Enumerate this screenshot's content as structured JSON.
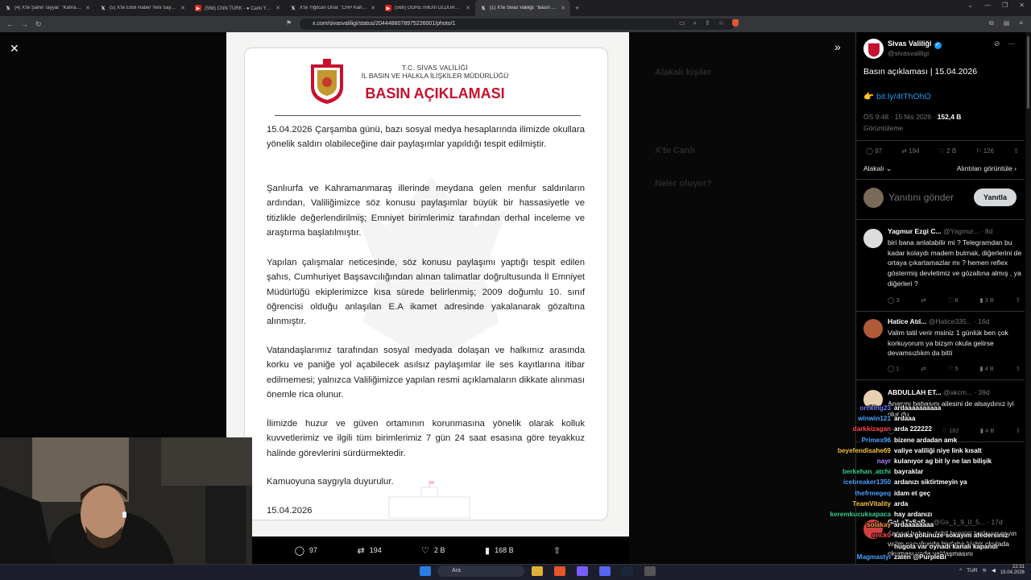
{
  "browser": {
    "tabs": [
      {
        "title": "(4) X'te Şamil Tayyar: \"Kahramanmaraş",
        "kind": "x"
      },
      {
        "title": "(5) X'te Etkili Haber Yeni Sayfa: \"Nevş",
        "kind": "x"
      },
      {
        "title": "(568) CNN TÜRK - ● Canlı Yayın ▾",
        "kind": "yt"
      },
      {
        "title": "X'te Yiğitcan Önal: \"CHP Kahramanm",
        "kind": "x"
      },
      {
        "title": "(568) ÖĞRETMENİ ÖLDÜRMEK!! (Kıs",
        "kind": "yt"
      },
      {
        "title": "(1) X'te Sivas Valiliği: \"Basın açıkla",
        "kind": "x"
      }
    ],
    "url": "x.com/sivasvaliligi/status/2044488078975226001/photo/1"
  },
  "document": {
    "header_line1": "T.C. SİVAS VALİLİĞİ",
    "header_line2": "İL BASIN VE HALKLA İLİŞKİLER MÜDÜRLÜĞÜ",
    "title": "BASIN AÇIKLAMASI",
    "paragraphs": [
      "15.04.2026 Çarşamba günü, bazı sosyal medya hesaplarında ilimizde okullara yönelik saldırı olabileceğine dair paylaşımlar yapıldığı tespit edilmiştir.",
      "Şanlıurfa ve Kahramanmaraş illerinde meydana gelen menfur saldırıların ardından, Valiliğimizce söz konusu paylaşımlar büyük bir hassasiyetle ve titizlikle değerlendirilmiş; Emniyet birimlerimiz tarafından derhal inceleme ve araştırma başlatılmıştır.",
      "Yapılan çalışmalar neticesinde, söz konusu paylaşımı yaptığı tespit edilen şahıs, Cumhuriyet Başsavcılığından alınan talimatlar doğrultusunda İl Emniyet Müdürlüğü ekiplerimizce kısa sürede belirlenmiş; 2009 doğumlu 10. sınıf öğrencisi olduğu anlaşılan E.A ikamet adresinde yakalanarak gözaltına alınmıştır.",
      "Vatandaşlarımız tarafından sosyal medyada dolaşan ve halkımız arasında korku ve paniğe yol açabilecek asılsız paylaşımlar ile ses kayıtlarına itibar edilmemesi; yalnızca Valiliğimizce yapılan resmi açıklamaların dikkate alınması önemle rica olunur.",
      "İlimizde huzur ve güven ortamının korunmasına yönelik olarak kolluk kuvvetlerimiz ve ilgili tüm birimlerimiz 7 gün 24 saat esasına göre teyakkuz halinde görevlerini sürdürmektedir."
    ],
    "closing": "Kamuoyuna saygıyla duyurulur.",
    "date": "15.04.2026"
  },
  "photo_actions": {
    "replies": "97",
    "reposts": "194",
    "likes": "2 B",
    "views": "168 B"
  },
  "background_text": {
    "related": "Alakalı kişiler",
    "x_live": "X'te Canlı",
    "whats_happening": "Neler oluyor?"
  },
  "post": {
    "name": "Sivas Valiliği",
    "handle": "@sivasvaliligi",
    "text": "Basın açıklaması | 15.04.2026",
    "link_emoji": "👉",
    "link": "bit.ly/4tThOhO",
    "time": "ÖS 9:48 · 15 Nis 2026 · ",
    "views": "152,4 B",
    "views_label": "Görüntüleme",
    "replies": "97",
    "reposts": "194",
    "likes": "2 B",
    "bookmarks": "126",
    "sort_label": "Alakalı",
    "quotes_label": "Alıntıları görüntüle",
    "reply_placeholder": "Yanıtını gönder",
    "reply_button": "Yanıtla"
  },
  "comments": [
    {
      "name": "Yagmur Ezgi C...",
      "handle": "@Yagmur... · 8d",
      "text": "biri bana anlatabilir mi ? Telegramdan bu kadar kolaydı madem bulmak, diğerlerini de ortaya çıkartamazlar mı ? hemen reflex göstermiş devletimiz ve gözaltına almış , ya diğerleri ?",
      "replies": "3",
      "likes": "8",
      "views": "3 B"
    },
    {
      "name": "Hatice Atıl...",
      "handle": "@Hatice335... · 16d",
      "text": "Valim tatil verir msiniz 1 günlük ben çok korkuyorum ya bizşm okula gelirse devamsızlıkm da bitti",
      "replies": "1",
      "likes": "5",
      "views": "4 B"
    },
    {
      "name": "ABDULLAH ET...",
      "handle": "@akcm... · 39d",
      "text": "Anasını babasını ailesini de alsaydınız iyi olur du",
      "replies": "",
      "likes": "182",
      "views": "4 B"
    },
    {
      "name": "GaLaTaSaR...",
      "handle": "@Gs_1_9_0_5... · 17d",
      "text": "Annesi babası dahil hepsini toplayın sayın valim çocuğunda birdaha hiçbir okulada okuması yada yaklaşmasını",
      "replies": "",
      "likes": "127",
      "views": "4 B"
    }
  ],
  "chat": [
    {
      "user": "orcking23",
      "msg": "ardaaaaaaaaaa",
      "color": "#6b7cff"
    },
    {
      "user": "winwin121",
      "msg": "ardaaa",
      "color": "#4aa3ff"
    },
    {
      "user": "darkkizagan",
      "msg": "arda 222222",
      "color": "#ff4d4d"
    },
    {
      "user": "Primex96",
      "msg": "bizene ardadan amk",
      "color": "#4aa3ff"
    },
    {
      "user": "beyefendisahe69",
      "msg": "valiye valiliği niye link kısalt",
      "color": "#f5c542"
    },
    {
      "user": "nayr",
      "msg": "kulanıyor ag bit ly ne lan bilişik",
      "color": "#b084ff"
    },
    {
      "user": "berkehan_atchi",
      "msg": "bayraklar",
      "color": "#3ccf8e"
    },
    {
      "user": "icebreaker1350",
      "msg": "ardanızı siktirtmeyin ya",
      "color": "#4aa3ff"
    },
    {
      "user": "thefrmegeq",
      "msg": "idam et geç",
      "color": "#4aa3ff"
    },
    {
      "user": "TeamVitality",
      "msg": "arda",
      "color": "#f5c542"
    },
    {
      "user": "keremkucuksapaca",
      "msg": "hay ardanızı",
      "color": "#3ccf8e"
    },
    {
      "user": "solakay",
      "msg": "ardaaaaaaaa",
      "color": "#ff9f40"
    },
    {
      "user": "enck0",
      "msg": "kanka golunuze sokayım afedersiniz",
      "color": "#ff4d4d"
    },
    {
      "user": "",
      "msg": "hugola var oynadı kanalı kapandı",
      "color": "#ffffff"
    },
    {
      "user": "Magmastyl",
      "msg": "zaten @PurpleBi",
      "color": "#4aa3ff"
    }
  ],
  "taskbar": {
    "search": "Ara",
    "lang": "TUR",
    "time": "22:31",
    "date": "15.04.2026"
  }
}
